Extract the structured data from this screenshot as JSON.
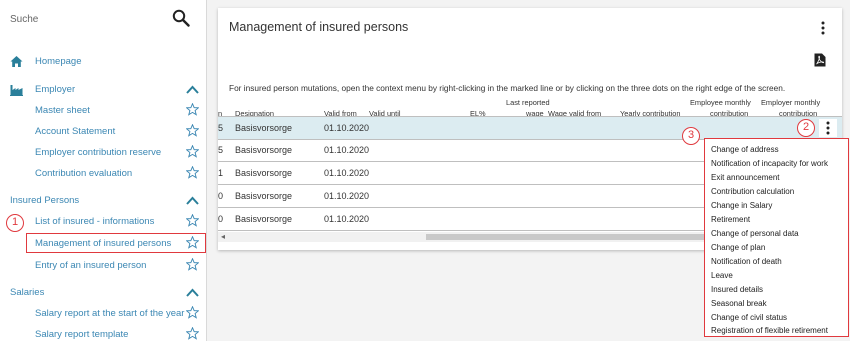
{
  "sidebar": {
    "search_placeholder": "Suche",
    "homepage": "Homepage",
    "employer": {
      "label": "Employer",
      "items": [
        "Master sheet",
        "Account Statement",
        "Employer contribution reserve",
        "Contribution evaluation"
      ]
    },
    "insured": {
      "label": "Insured Persons",
      "items": [
        "List of insured - informations",
        "Management of insured persons",
        "Entry of an insured person"
      ]
    },
    "salaries": {
      "label": "Salaries",
      "items": [
        "Salary report at the start of the year",
        "Salary report template"
      ]
    }
  },
  "badges": [
    "1",
    "2",
    "3"
  ],
  "main": {
    "title": "Management of insured persons",
    "info": "For insured person mutations, open the context menu by right-clicking in the marked line or by clicking on the three dots on the right edge of the screen.",
    "headers": {
      "n": "n",
      "designation": "Designation",
      "valid_from": "Valid from",
      "valid_until": "Valid until",
      "el": "EL%",
      "last_reported_1": "Last reported",
      "last_reported_2": "wage",
      "wage_valid_from": "Wage valid from",
      "yearly": "Yearly contribution",
      "emp_monthly_1": "Employee monthly",
      "emp_monthly_2": "contribution",
      "employer_monthly_1": "Employer monthly",
      "employer_monthly_2": "contribution"
    },
    "rows": [
      {
        "n": "5",
        "designation": "Basisvorsorge",
        "valid_from": "01.10.2020"
      },
      {
        "n": "5",
        "designation": "Basisvorsorge",
        "valid_from": "01.10.2020"
      },
      {
        "n": "1",
        "designation": "Basisvorsorge",
        "valid_from": "01.10.2020"
      },
      {
        "n": "0",
        "designation": "Basisvorsorge",
        "valid_from": "01.10.2020"
      },
      {
        "n": "0",
        "designation": "Basisvorsorge",
        "valid_from": "01.10.2020"
      }
    ]
  },
  "context_menu": [
    "Change of address",
    "Notification of incapacity for work",
    "Exit announcement",
    "Contribution calculation",
    "Change in Salary",
    "Retirement",
    "Change of personal data",
    "Change of plan",
    "Notification of death",
    "Leave",
    "Insured details",
    "Seasonal break",
    "Change of civil status",
    "Registration of flexible retirement"
  ],
  "colors": {
    "accent": "#3b87b3",
    "highlight": "#e0393e",
    "selected_row": "#dcecf1",
    "icon_teal": "#2a7f9a"
  }
}
